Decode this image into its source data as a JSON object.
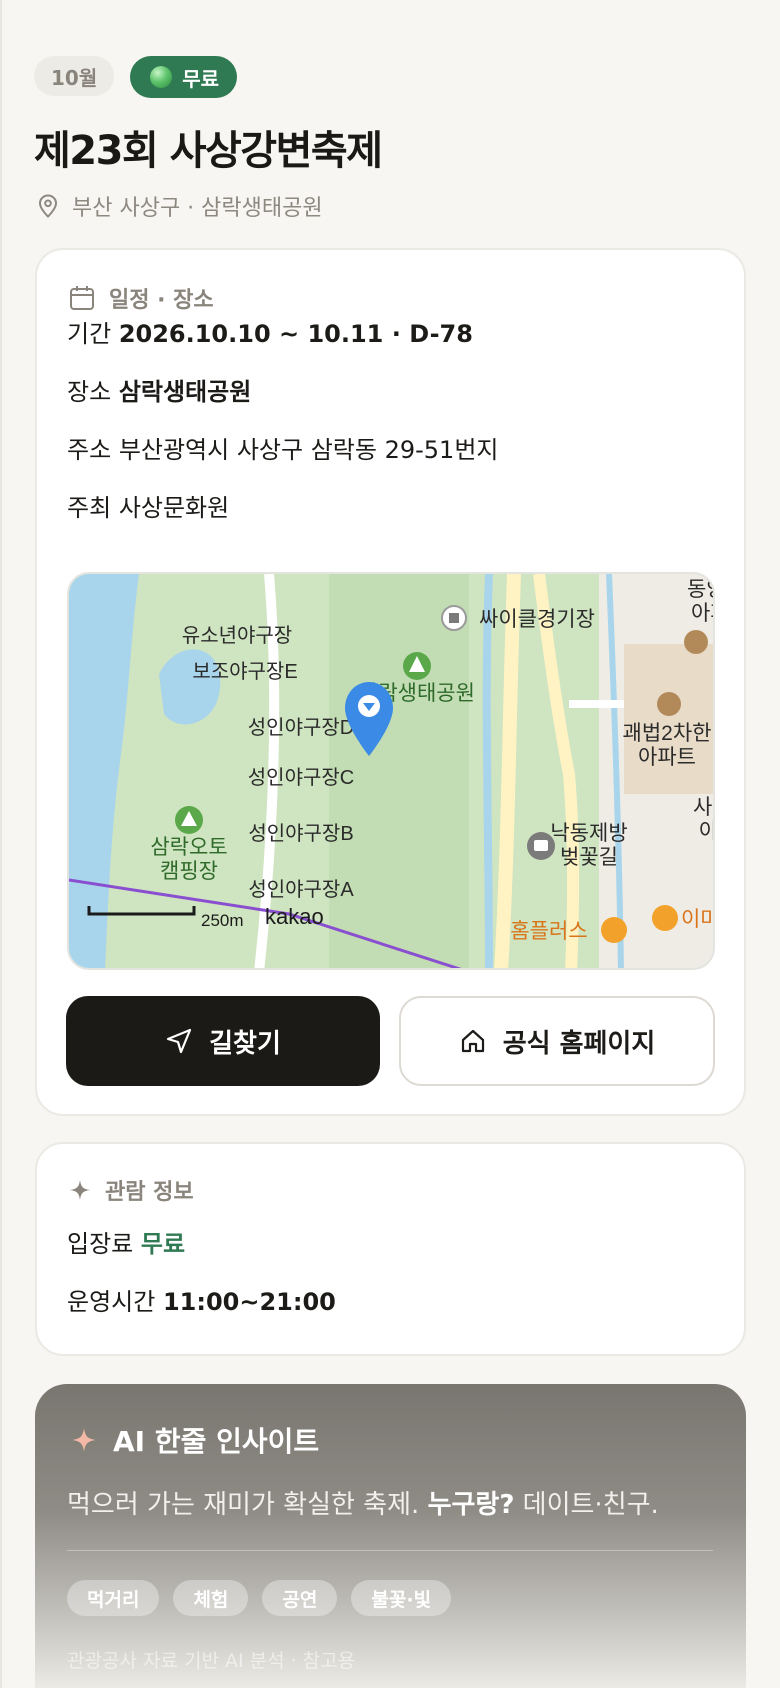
{
  "badges": {
    "month": "10월",
    "price": "무료"
  },
  "title": "제23회 사상강변축제",
  "location": "부산 사상구 · 삼락생태공원",
  "schedule": {
    "heading": "일정 · 장소",
    "period_label": "기간",
    "period_value": "2026.10.10 ~ 10.11 · D-78",
    "venue_label": "장소",
    "venue_value": "삼락생태공원",
    "address_label": "주소",
    "address_value": "부산광역시 사상구 삼락동 29-51번지",
    "host_label": "주최",
    "host_value": "사상문화원"
  },
  "map": {
    "labels": {
      "youth_field": "유소년야구장",
      "aux_field_e": "보조야구장E",
      "park": "삼락생태공원",
      "field_d": "성인야구장D",
      "field_c": "성인야구장C",
      "field_b": "성인야구장B",
      "field_a": "성인야구장A",
      "cycle": "싸이클경기장",
      "camping_1": "삼락오토",
      "camping_2": "캠핑장",
      "cherry_1": "낙동제방",
      "cherry_2": "벚꽃길",
      "apt1_1": "괘법2차한",
      "apt1_2": "아파트",
      "apt2_1": "동양",
      "apt2_2": "아파",
      "apt3_1": "사상",
      "apt3_2": "아파",
      "homeplus": "홈플러스",
      "emart": "이마"
    },
    "scale": "250m",
    "brand": "kakao"
  },
  "buttons": {
    "directions": "길찾기",
    "homepage": "공식 홈페이지"
  },
  "info": {
    "heading": "관람 정보",
    "fee_label": "입장료",
    "fee_value": "무료",
    "hours_label": "운영시간",
    "hours_value": "11:00~21:00"
  },
  "ai": {
    "heading": "AI 한줄 인사이트",
    "text_plain": "먹으러 가는 재미가 확실한 축제.",
    "text_bold": "누구랑?",
    "text_tail": "데이트·친구.",
    "tags": [
      "먹거리",
      "체험",
      "공연",
      "불꽃·빛"
    ],
    "note": "관광공사 자료 기반 AI 분석 · 참고용"
  },
  "colors": {
    "accent_green": "#2f7a53",
    "dark": "#1c1a17",
    "map_water": "#a9d5ec",
    "map_green": "#cfe4c0"
  }
}
